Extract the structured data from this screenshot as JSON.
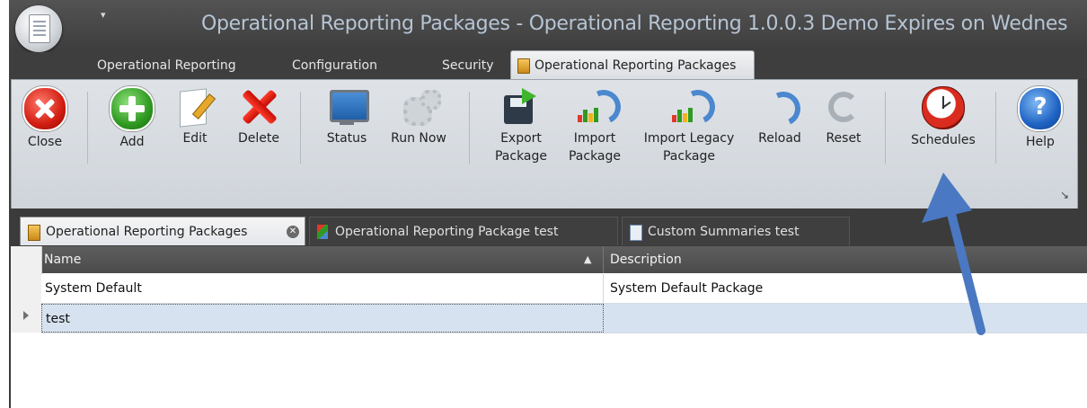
{
  "window": {
    "title": "Operational Reporting Packages - Operational Reporting 1.0.0.3 Demo Expires on Wednes",
    "qat_glyph": "▾"
  },
  "ribbon_tabs": [
    {
      "label": "Operational Reporting",
      "active": false
    },
    {
      "label": "Configuration",
      "active": false
    },
    {
      "label": "Security",
      "active": false
    },
    {
      "label": "Operational Reporting Packages",
      "active": true
    }
  ],
  "ribbon": {
    "close": "Close",
    "add": "Add",
    "edit": "Edit",
    "delete": "Delete",
    "status": "Status",
    "run_now": "Run Now",
    "export_package_1": "Export",
    "export_package_2": "Package",
    "import_package_1": "Import",
    "import_package_2": "Package",
    "import_legacy_1": "Import Legacy",
    "import_legacy_2": "Package",
    "reload": "Reload",
    "reset": "Reset",
    "schedules": "Schedules",
    "help": "Help",
    "launcher_glyph": "↘"
  },
  "document_tabs": [
    {
      "label": "Operational Reporting Packages",
      "active": true
    },
    {
      "label": "Operational Reporting Package test",
      "active": false
    },
    {
      "label": "Custom Summaries test",
      "active": false
    }
  ],
  "grid": {
    "columns": {
      "name": "Name",
      "description": "Description"
    },
    "sort_glyph": "▲",
    "rows": [
      {
        "name": "System Default",
        "description": "System Default Package",
        "selected": false
      },
      {
        "name": "test",
        "description": "",
        "selected": true
      }
    ]
  },
  "colors": {
    "frame": "#3b3b3b",
    "title_text": "#b6c4d4",
    "ribbon_bg": "#d8dce1",
    "selected_row": "#d6e2ef",
    "annotation_arrow": "#4a78c2"
  }
}
